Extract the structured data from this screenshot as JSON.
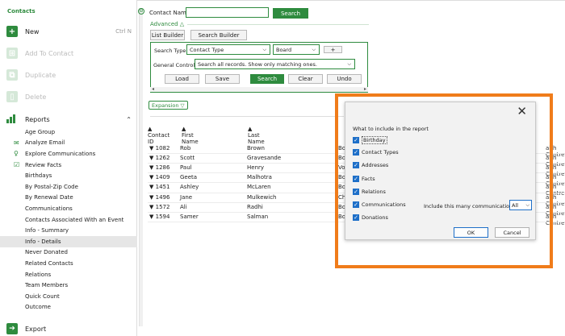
{
  "sidebar": {
    "title": "Contacts",
    "actions": [
      {
        "label": "New",
        "shortcut": "Ctrl N",
        "enabled": true
      },
      {
        "label": "Add To Contact",
        "shortcut": "",
        "enabled": false
      },
      {
        "label": "Duplicate",
        "shortcut": "",
        "enabled": false
      },
      {
        "label": "Delete",
        "shortcut": "",
        "enabled": false
      }
    ],
    "reports_label": "Reports",
    "reports_chevron": "⌃",
    "items": [
      {
        "label": "Age Group"
      },
      {
        "label": "Analyze Email"
      },
      {
        "label": "Explore Communications"
      },
      {
        "label": "Review Facts"
      },
      {
        "label": "Birthdays"
      },
      {
        "label": "By Postal-Zip Code"
      },
      {
        "label": "By Renewal Date"
      },
      {
        "label": "Communications"
      },
      {
        "label": "Contacts Associated With an Event"
      },
      {
        "label": "Info - Summary"
      },
      {
        "label": "Info - Details"
      },
      {
        "label": "Never Donated"
      },
      {
        "label": "Related Contacts"
      },
      {
        "label": "Relations"
      },
      {
        "label": "Team Members"
      },
      {
        "label": "Quick Count"
      },
      {
        "label": "Outcome"
      }
    ],
    "selected_index": 10,
    "export_label": "Export"
  },
  "search": {
    "contact_name_label": "Contact Name",
    "contact_name_value": "",
    "search_button": "Search",
    "advanced_label": "Advanced △",
    "list_builder": "List Builder",
    "search_builder": "Search Builder",
    "search_type_label": "Search Type:",
    "search_type_value": "Contact Type",
    "board_value": "Board",
    "plus_label": "+",
    "general_control_label": "General Control:",
    "general_control_value": "Search all records. Show only matching ones.",
    "load": "Load",
    "save": "Save",
    "search2": "Search",
    "clear": "Clear",
    "undo": "Undo",
    "scroll_left": "◂",
    "scroll_right": "▸",
    "expansion": "Expansion ▽"
  },
  "table": {
    "headers": [
      "Contact ID",
      "First Name",
      "Last Name"
    ],
    "rows": [
      {
        "id": "1082",
        "first": "Rob",
        "last": "Brown",
        "col4": "Bo",
        "col5": "alth Centre"
      },
      {
        "id": "1262",
        "first": "Scott",
        "last": "Gravesande",
        "col4": "Bo",
        "col5": "alth Centre"
      },
      {
        "id": "1286",
        "first": "Paul",
        "last": "Henry",
        "col4": "Vo",
        "col5": "alth Centre"
      },
      {
        "id": "1409",
        "first": "Geeta",
        "last": "Malhotra",
        "col4": "Bo",
        "col5": "alth Centre"
      },
      {
        "id": "1451",
        "first": "Ashley",
        "last": "McLaren",
        "col4": "Bo",
        "col5": "alth Centre"
      },
      {
        "id": "1496",
        "first": "Jane",
        "last": "Mulkewich",
        "col4": "Ch",
        "col5": "alth Centre"
      },
      {
        "id": "1572",
        "first": "Ali",
        "last": "Radhi",
        "col4": "Bo",
        "col5": "alth Centre"
      },
      {
        "id": "1594",
        "first": "Samer",
        "last": "Salman",
        "col4": "Bo",
        "col5": "alth Centre"
      }
    ]
  },
  "modal": {
    "close": "✕",
    "heading": "What to include in the report",
    "options": [
      {
        "label": "Birthday",
        "checked": true
      },
      {
        "label": "Contact Types",
        "checked": true
      },
      {
        "label": "Addresses",
        "checked": true
      },
      {
        "label": "Facts",
        "checked": true
      },
      {
        "label": "Relations",
        "checked": true
      },
      {
        "label": "Communications",
        "checked": true
      },
      {
        "label": "Donations",
        "checked": true
      }
    ],
    "include_label": "Include this many communications:",
    "include_value": "All",
    "ok": "OK",
    "cancel": "Cancel",
    "highlight_color": "#f07c1a"
  }
}
